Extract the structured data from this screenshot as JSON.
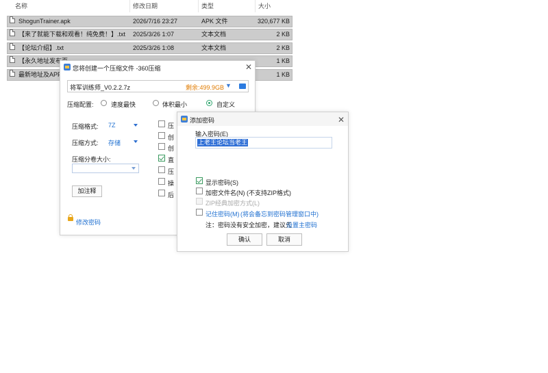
{
  "explorer": {
    "headers": {
      "name": "名称",
      "date": "修改日期",
      "type": "类型",
      "size": "大小"
    },
    "sort_indicator": "^",
    "files": [
      {
        "name": "ShogunTrainer.apk",
        "date": "2026/7/16 23:27",
        "type": "APK 文件",
        "size": "320,677 KB"
      },
      {
        "name": "【来了就能下载和观看！纯免费！】.txt",
        "date": "2025/3/26 1:07",
        "type": "文本文档",
        "size": "2 KB"
      },
      {
        "name": "【论坛介绍】.txt",
        "date": "2025/3/26 1:08",
        "type": "文本文档",
        "size": "2 KB"
      },
      {
        "name": "【永久地址发布页",
        "date": "",
        "type": "",
        "size": "1 KB"
      },
      {
        "name": "最新地址及APP",
        "date": "",
        "type": "",
        "size": "1 KB"
      }
    ]
  },
  "compress_dialog": {
    "title": "您将创建一个压缩文件 -360压缩",
    "close": "✕",
    "filename": "将军训练师_V0.2.2.7z",
    "free_space": "剩余:499.9GB",
    "config_label": "压缩配置:",
    "options": [
      "速度最快",
      "体积最小",
      "自定义"
    ],
    "format_label": "压缩格式:",
    "format_value": "7Z",
    "method_label": "压缩方式:",
    "method_value": "存储",
    "split_label": "压缩分卷大小:",
    "comment_button": "加注释",
    "right_checks": [
      "压",
      "创",
      "创",
      "直",
      "压",
      "操",
      "后"
    ],
    "change_password": "修改密码"
  },
  "password_dialog": {
    "title": "添加密码",
    "close": "✕",
    "input_label": "输入密码(E)",
    "password_value": "上老王论坛当老王",
    "show_password": "显示密码(S)",
    "encrypt_names": "加密文件名(N) (不支持ZIP格式)",
    "zip_classic": "ZIP经典加密方式(L)",
    "remember_password": "记住密码(M)",
    "remember_note": "(将会备忘到密码管理窗口中)",
    "note_prefix": "注：密码没有安全加密，建议先",
    "note_link": "设置主密码",
    "ok_button": "确认",
    "cancel_button": "取消"
  }
}
